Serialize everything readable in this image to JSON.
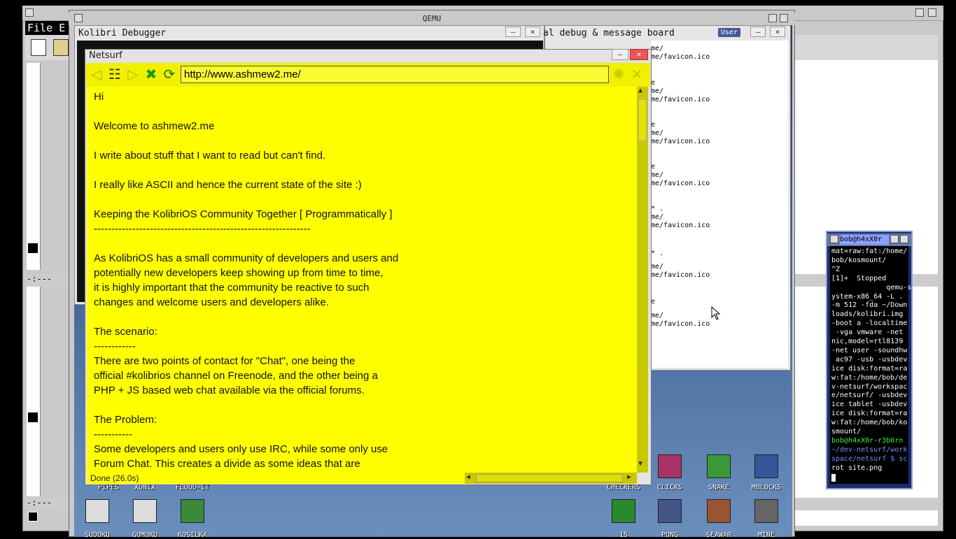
{
  "host": {
    "qemu_title": "QEMU",
    "emacs_menu_text": "File E",
    "modeline_text": "-:---"
  },
  "debugger": {
    "title": "Kolibri Debugger",
    "min_label": "–",
    "close_label": "×"
  },
  "board": {
    "title": "al debug & message board",
    "user_badge": "User",
    "min_label": "–",
    "close_label": "×",
    "lines": [
      "me/",
      "me/favicon.ico",
      "e",
      "me/",
      "me/favicon.ico",
      "e",
      "me/",
      "me/favicon.ico",
      "e",
      "me/",
      "me/favicon.ico",
      "* .",
      "me/",
      "me/favicon.ico",
      "* .",
      "me/",
      "me/favicon.ico",
      "e",
      "me/",
      "me/favicon.ico"
    ]
  },
  "netsurf": {
    "title": "Netsurf",
    "url": "http://www.ashmew2.me/",
    "status": "Done (26.0s)",
    "content_lines": [
      "Hi",
      "",
      "Welcome to ashmew2.me",
      "",
      "I write about stuff that I want to read but can't find.",
      "",
      "I really like ASCII and hence the current state of the site :)",
      "",
      "Keeping the KolibriOS Community Together [ Programmatically ]",
      "--------------------------------------------------------------",
      "",
      "As KolibriOS has a small community of developers and users and",
      "potentially new developers keep showing up from time to time,",
      "it is highly important that the community be reactive to such",
      "changes and welcome users and developers alike.",
      "",
      "The scenario:",
      "------------",
      "There are two points of contact for \"Chat\", one being the",
      "official #kolibrios channel on Freenode, and the other being a",
      "PHP + JS based web chat available via the official forums.",
      "",
      "The Problem:",
      "-----------",
      "Some developers and users only use IRC, while some only use",
      "Forum Chat. This creates a divide as some ideas that are"
    ]
  },
  "terminal": {
    "title": "bob@h4xX0r",
    "lines": [
      {
        "text": "mat=raw:fat:/home/",
        "cls": ""
      },
      {
        "text": "bob/kosmount/",
        "cls": ""
      },
      {
        "text": "^Z",
        "cls": ""
      },
      {
        "text": "[1]+  Stopped",
        "cls": ""
      },
      {
        "text": "             qemu-s",
        "cls": ""
      },
      {
        "text": "ystem-x86_64 -L .",
        "cls": ""
      },
      {
        "text": "-m 512 -fda ~/Down",
        "cls": ""
      },
      {
        "text": "loads/kolibri.img",
        "cls": ""
      },
      {
        "text": "-boot a -localtime",
        "cls": ""
      },
      {
        "text": " -vga vmware -net",
        "cls": ""
      },
      {
        "text": "nic,model=rtl8139",
        "cls": ""
      },
      {
        "text": "-net user -soundhw",
        "cls": ""
      },
      {
        "text": " ac97 -usb -usbdev",
        "cls": ""
      },
      {
        "text": "ice disk:format=ra",
        "cls": ""
      },
      {
        "text": "w:fat:/home/bob/de",
        "cls": ""
      },
      {
        "text": "v-netsurf/workspac",
        "cls": ""
      },
      {
        "text": "e/netsurf/ -usbdev",
        "cls": ""
      },
      {
        "text": "ice tablet -usbdev",
        "cls": ""
      },
      {
        "text": "ice disk:format=ra",
        "cls": ""
      },
      {
        "text": "w:fat:/home/bob/ko",
        "cls": ""
      },
      {
        "text": "smount/",
        "cls": ""
      },
      {
        "text": "bob@h4xX0r-r3b0rn",
        "cls": "term-green"
      },
      {
        "text": "~/dev-netsurf/work",
        "cls": "term-blue"
      },
      {
        "text": "space/netsurf $ sc",
        "cls": "term-blue"
      },
      {
        "text": "rot site.png",
        "cls": ""
      }
    ]
  },
  "desktop_icons": [
    {
      "label": "PIPES",
      "name": "pipes-icon"
    },
    {
      "label": "XONIX",
      "name": "xonix-icon"
    },
    {
      "label": "FLOOD-IT",
      "name": "flood-it-icon"
    },
    {
      "label": "CHECKERS",
      "name": "checkers-icon"
    },
    {
      "label": "CLICKS",
      "name": "clicks-icon"
    },
    {
      "label": "SNAKE",
      "name": "snake-icon"
    },
    {
      "label": "MBLOCKS",
      "name": "mblocks-icon"
    },
    {
      "label": "SUDOKU",
      "name": "sudoku-icon"
    },
    {
      "label": "GOMOKU",
      "name": "gomoku-icon"
    },
    {
      "label": "KOSILKA",
      "name": "kosilka-icon"
    },
    {
      "label": "15",
      "name": "fifteen-icon"
    },
    {
      "label": "PONG",
      "name": "pong-icon"
    },
    {
      "label": "SEAWAR",
      "name": "seawar-icon"
    },
    {
      "label": "MINE",
      "name": "mine-icon"
    }
  ],
  "colors": {
    "netsurf_bg": "#ffff00",
    "terminal_bg": "#000000",
    "terminal_prompt_user": "#3cf03c",
    "terminal_prompt_path": "#7090ff"
  }
}
